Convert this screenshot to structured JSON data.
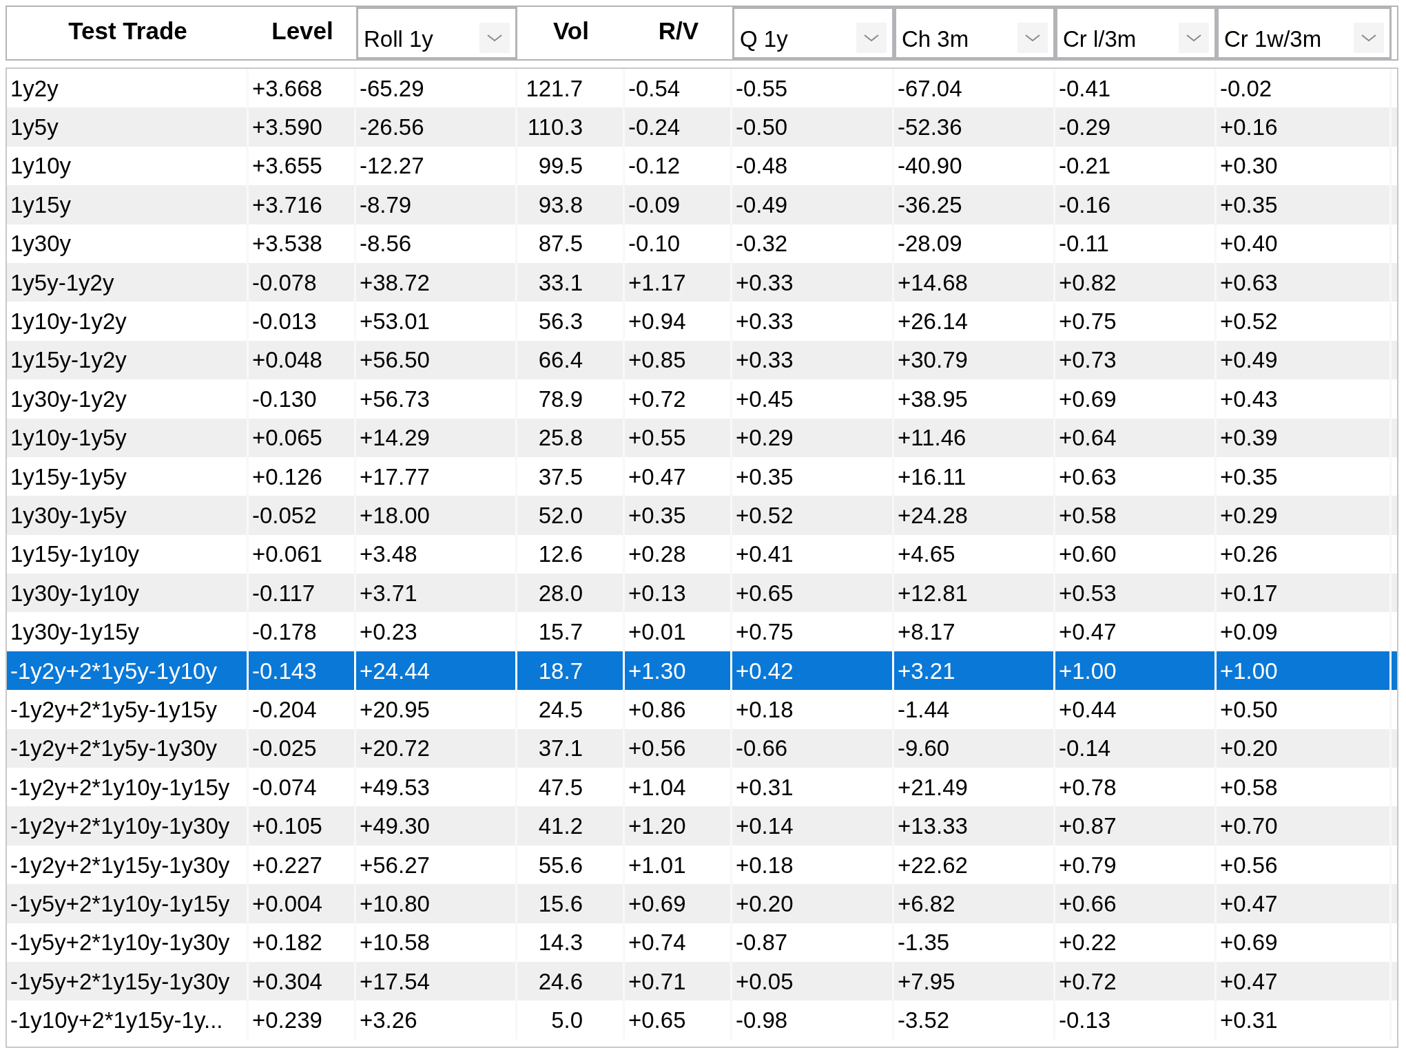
{
  "table": {
    "columns": [
      {
        "label": "Test Trade",
        "kind": "plain"
      },
      {
        "label": "Level",
        "kind": "plain"
      },
      {
        "label": "Roll 1y",
        "kind": "dropdown"
      },
      {
        "label": "Vol",
        "kind": "plain"
      },
      {
        "label": "R/V",
        "kind": "plain"
      },
      {
        "label": "Q 1y",
        "kind": "dropdown"
      },
      {
        "label": "Ch 3m",
        "kind": "dropdown"
      },
      {
        "label": "Cr l/3m",
        "kind": "dropdown"
      },
      {
        "label": "Cr 1w/3m",
        "kind": "dropdown"
      }
    ],
    "rows": [
      {
        "cells": [
          "1y2y",
          "+3.668",
          "-65.29",
          "121.7",
          "-0.54",
          "-0.55",
          "-67.04",
          "-0.41",
          "-0.02"
        ],
        "selected": false
      },
      {
        "cells": [
          "1y5y",
          "+3.590",
          "-26.56",
          "110.3",
          "-0.24",
          "-0.50",
          "-52.36",
          "-0.29",
          "+0.16"
        ],
        "selected": false
      },
      {
        "cells": [
          "1y10y",
          "+3.655",
          "-12.27",
          "99.5",
          "-0.12",
          "-0.48",
          "-40.90",
          "-0.21",
          "+0.30"
        ],
        "selected": false
      },
      {
        "cells": [
          "1y15y",
          "+3.716",
          "-8.79",
          "93.8",
          "-0.09",
          "-0.49",
          "-36.25",
          "-0.16",
          "+0.35"
        ],
        "selected": false
      },
      {
        "cells": [
          "1y30y",
          "+3.538",
          "-8.56",
          "87.5",
          "-0.10",
          "-0.32",
          "-28.09",
          "-0.11",
          "+0.40"
        ],
        "selected": false
      },
      {
        "cells": [
          "1y5y-1y2y",
          "-0.078",
          "+38.72",
          "33.1",
          "+1.17",
          "+0.33",
          "+14.68",
          "+0.82",
          "+0.63"
        ],
        "selected": false
      },
      {
        "cells": [
          "1y10y-1y2y",
          "-0.013",
          "+53.01",
          "56.3",
          "+0.94",
          "+0.33",
          "+26.14",
          "+0.75",
          "+0.52"
        ],
        "selected": false
      },
      {
        "cells": [
          "1y15y-1y2y",
          "+0.048",
          "+56.50",
          "66.4",
          "+0.85",
          "+0.33",
          "+30.79",
          "+0.73",
          "+0.49"
        ],
        "selected": false
      },
      {
        "cells": [
          "1y30y-1y2y",
          "-0.130",
          "+56.73",
          "78.9",
          "+0.72",
          "+0.45",
          "+38.95",
          "+0.69",
          "+0.43"
        ],
        "selected": false
      },
      {
        "cells": [
          "1y10y-1y5y",
          "+0.065",
          "+14.29",
          "25.8",
          "+0.55",
          "+0.29",
          "+11.46",
          "+0.64",
          "+0.39"
        ],
        "selected": false
      },
      {
        "cells": [
          "1y15y-1y5y",
          "+0.126",
          "+17.77",
          "37.5",
          "+0.47",
          "+0.35",
          "+16.11",
          "+0.63",
          "+0.35"
        ],
        "selected": false
      },
      {
        "cells": [
          "1y30y-1y5y",
          "-0.052",
          "+18.00",
          "52.0",
          "+0.35",
          "+0.52",
          "+24.28",
          "+0.58",
          "+0.29"
        ],
        "selected": false
      },
      {
        "cells": [
          "1y15y-1y10y",
          "+0.061",
          "+3.48",
          "12.6",
          "+0.28",
          "+0.41",
          "+4.65",
          "+0.60",
          "+0.26"
        ],
        "selected": false
      },
      {
        "cells": [
          "1y30y-1y10y",
          "-0.117",
          "+3.71",
          "28.0",
          "+0.13",
          "+0.65",
          "+12.81",
          "+0.53",
          "+0.17"
        ],
        "selected": false
      },
      {
        "cells": [
          "1y30y-1y15y",
          "-0.178",
          "+0.23",
          "15.7",
          "+0.01",
          "+0.75",
          "+8.17",
          "+0.47",
          "+0.09"
        ],
        "selected": false
      },
      {
        "cells": [
          "-1y2y+2*1y5y-1y10y",
          "-0.143",
          "+24.44",
          "18.7",
          "+1.30",
          "+0.42",
          "+3.21",
          "+1.00",
          "+1.00"
        ],
        "selected": true
      },
      {
        "cells": [
          "-1y2y+2*1y5y-1y15y",
          "-0.204",
          "+20.95",
          "24.5",
          "+0.86",
          "+0.18",
          "-1.44",
          "+0.44",
          "+0.50"
        ],
        "selected": false
      },
      {
        "cells": [
          "-1y2y+2*1y5y-1y30y",
          "-0.025",
          "+20.72",
          "37.1",
          "+0.56",
          "-0.66",
          "-9.60",
          "-0.14",
          "+0.20"
        ],
        "selected": false
      },
      {
        "cells": [
          "-1y2y+2*1y10y-1y15y",
          "-0.074",
          "+49.53",
          "47.5",
          "+1.04",
          "+0.31",
          "+21.49",
          "+0.78",
          "+0.58"
        ],
        "selected": false
      },
      {
        "cells": [
          "-1y2y+2*1y10y-1y30y",
          "+0.105",
          "+49.30",
          "41.2",
          "+1.20",
          "+0.14",
          "+13.33",
          "+0.87",
          "+0.70"
        ],
        "selected": false
      },
      {
        "cells": [
          "-1y2y+2*1y15y-1y30y",
          "+0.227",
          "+56.27",
          "55.6",
          "+1.01",
          "+0.18",
          "+22.62",
          "+0.79",
          "+0.56"
        ],
        "selected": false
      },
      {
        "cells": [
          "-1y5y+2*1y10y-1y15y",
          "+0.004",
          "+10.80",
          "15.6",
          "+0.69",
          "+0.20",
          "+6.82",
          "+0.66",
          "+0.47"
        ],
        "selected": false
      },
      {
        "cells": [
          "-1y5y+2*1y10y-1y30y",
          "+0.182",
          "+10.58",
          "14.3",
          "+0.74",
          "-0.87",
          "-1.35",
          "+0.22",
          "+0.69"
        ],
        "selected": false
      },
      {
        "cells": [
          "-1y5y+2*1y15y-1y30y",
          "+0.304",
          "+17.54",
          "24.6",
          "+0.71",
          "+0.05",
          "+7.95",
          "+0.72",
          "+0.47"
        ],
        "selected": false
      },
      {
        "cells": [
          "-1y10y+2*1y15y-1y...",
          "+0.239",
          "+3.26",
          "5.0",
          "+0.65",
          "-0.98",
          "-3.52",
          "-0.13",
          "+0.31"
        ],
        "selected": false
      }
    ]
  }
}
